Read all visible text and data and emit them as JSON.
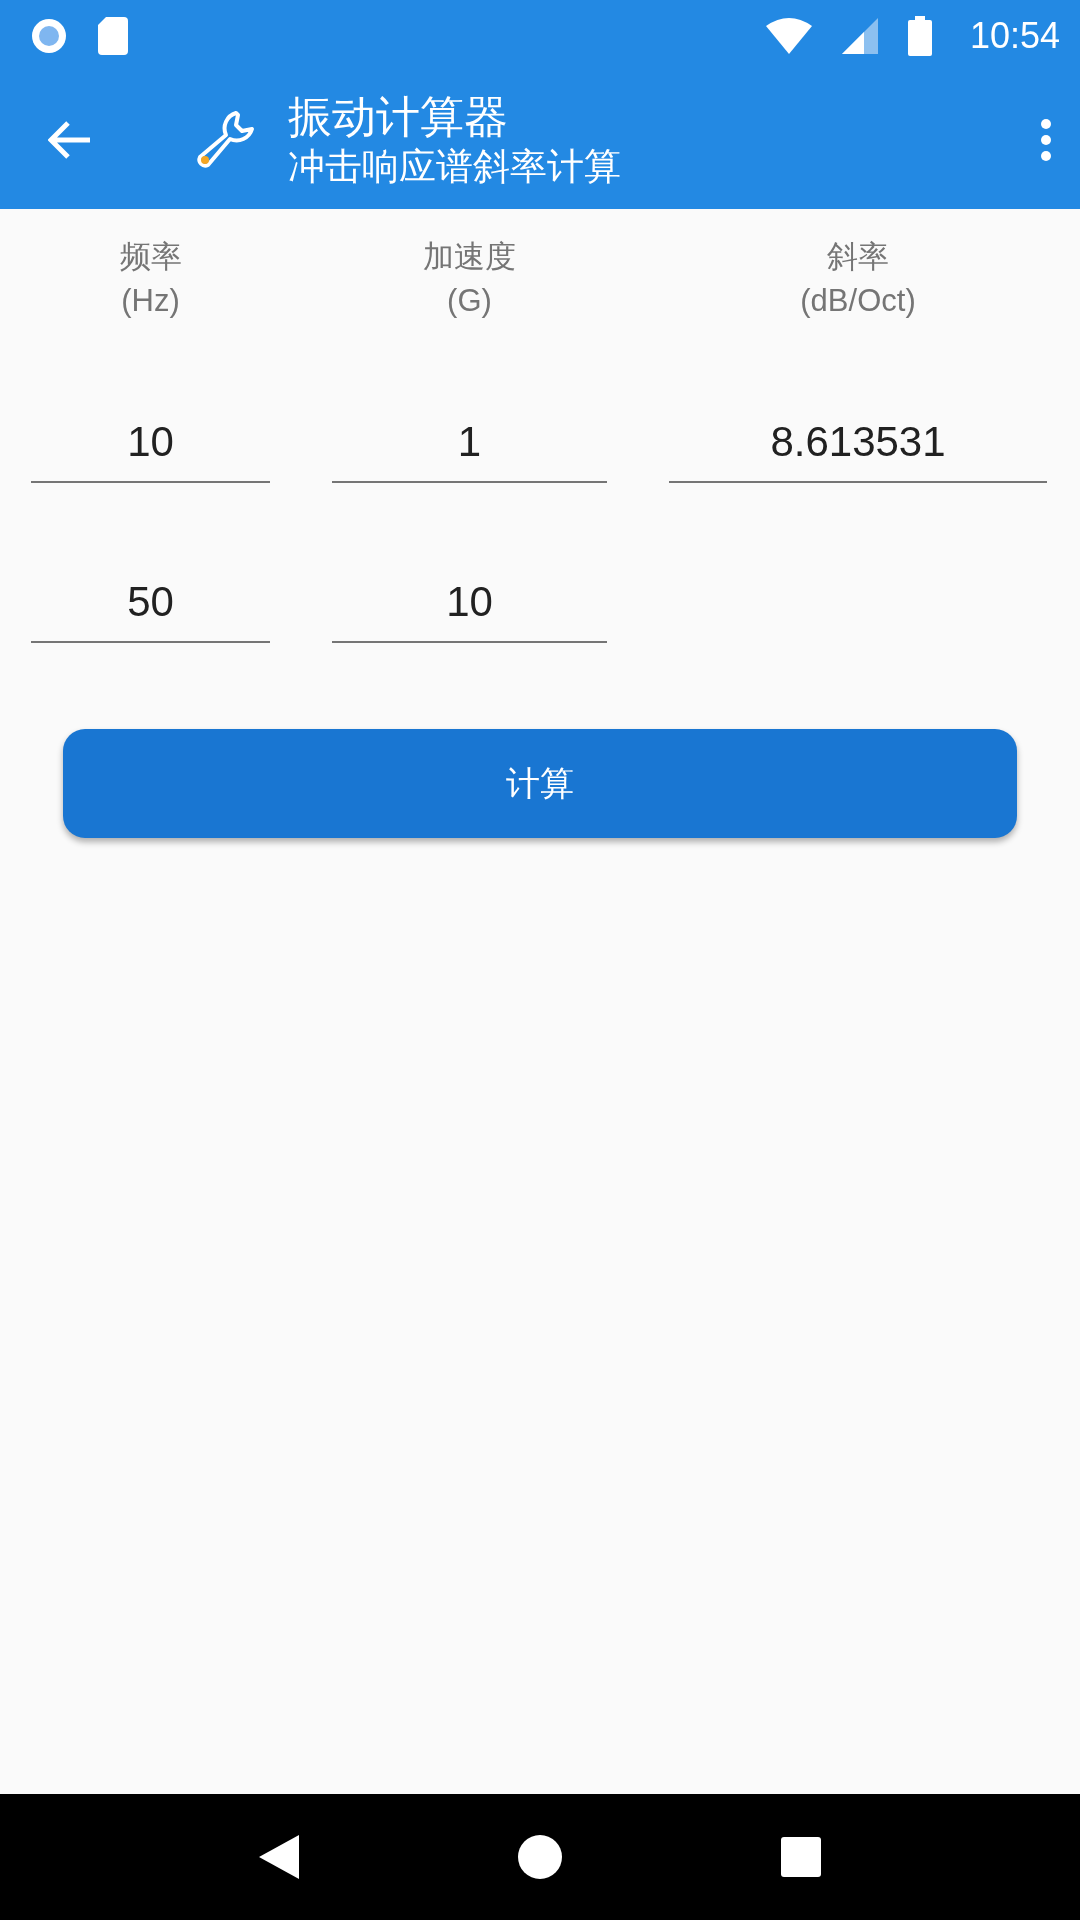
{
  "status_bar": {
    "time": "10:54"
  },
  "toolbar": {
    "title": "振动计算器",
    "subtitle": "冲击响应谱斜率计算"
  },
  "columns": [
    {
      "name": "频率",
      "unit": "(Hz)"
    },
    {
      "name": "加速度",
      "unit": "(G)"
    },
    {
      "name": "斜率",
      "unit": "(dB/Oct)"
    }
  ],
  "rows": [
    {
      "values": [
        "10",
        "1",
        "8.613531"
      ]
    },
    {
      "values": [
        "50",
        "10"
      ]
    }
  ],
  "button": "计算"
}
